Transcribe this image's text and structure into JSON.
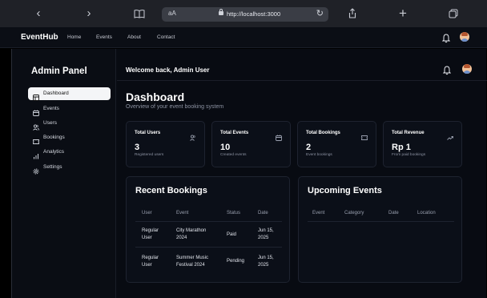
{
  "browser": {
    "url_aa": "aA",
    "url": "http://localhost:3000",
    "back_icon": "chevron-left",
    "forward_icon": "chevron-right",
    "reader_icon": "book",
    "reload_icon": "reload",
    "share_icon": "share",
    "new_tab_icon": "plus",
    "tabs_icon": "tabs"
  },
  "topnav": {
    "brand": "EventHub",
    "links": [
      "Home",
      "Events",
      "About",
      "Contact"
    ]
  },
  "sidebar": {
    "title": "Admin Panel",
    "items": [
      {
        "label": "Dashboard",
        "icon": "dashboard-icon",
        "active": true
      },
      {
        "label": "Events",
        "icon": "calendar-icon",
        "active": false
      },
      {
        "label": "Users",
        "icon": "users-icon",
        "active": false
      },
      {
        "label": "Bookings",
        "icon": "ticket-icon",
        "active": false
      },
      {
        "label": "Analytics",
        "icon": "bar-chart-icon",
        "active": false
      },
      {
        "label": "Settings",
        "icon": "gear-icon",
        "active": false
      }
    ]
  },
  "header": {
    "welcome": "Welcome back, Admin User"
  },
  "dashboard": {
    "title": "Dashboard",
    "subtitle": "Overview of your event booking system"
  },
  "stats": [
    {
      "label": "Total Users",
      "value": "3",
      "sub": "Registered users",
      "icon": "users-icon"
    },
    {
      "label": "Total Events",
      "value": "10",
      "sub": "Created events",
      "icon": "calendar-icon"
    },
    {
      "label": "Total Bookings",
      "value": "2",
      "sub": "Event bookings",
      "icon": "ticket-icon"
    },
    {
      "label": "Total Revenue",
      "value": "Rp 1",
      "sub": "From paid bookings",
      "icon": "trending-up-icon"
    }
  ],
  "recent_bookings": {
    "title": "Recent Bookings",
    "columns": [
      "User",
      "Event",
      "Status",
      "Date"
    ],
    "rows": [
      {
        "user": "Regular\nUser",
        "event": "City Marathon\n2024",
        "status": "Paid",
        "date": "Jun 15,\n2025"
      },
      {
        "user": "Regular\nUser",
        "event": "Summer Music\nFestival 2024",
        "status": "Pending",
        "date": "Jun 15,\n2025"
      }
    ]
  },
  "upcoming_events": {
    "title": "Upcoming Events",
    "columns": [
      "Event",
      "Category",
      "Date",
      "Location"
    ]
  },
  "colors": {
    "background": "#080b12",
    "active_item": "#f4f5f7",
    "card_border": "#1e2330"
  }
}
